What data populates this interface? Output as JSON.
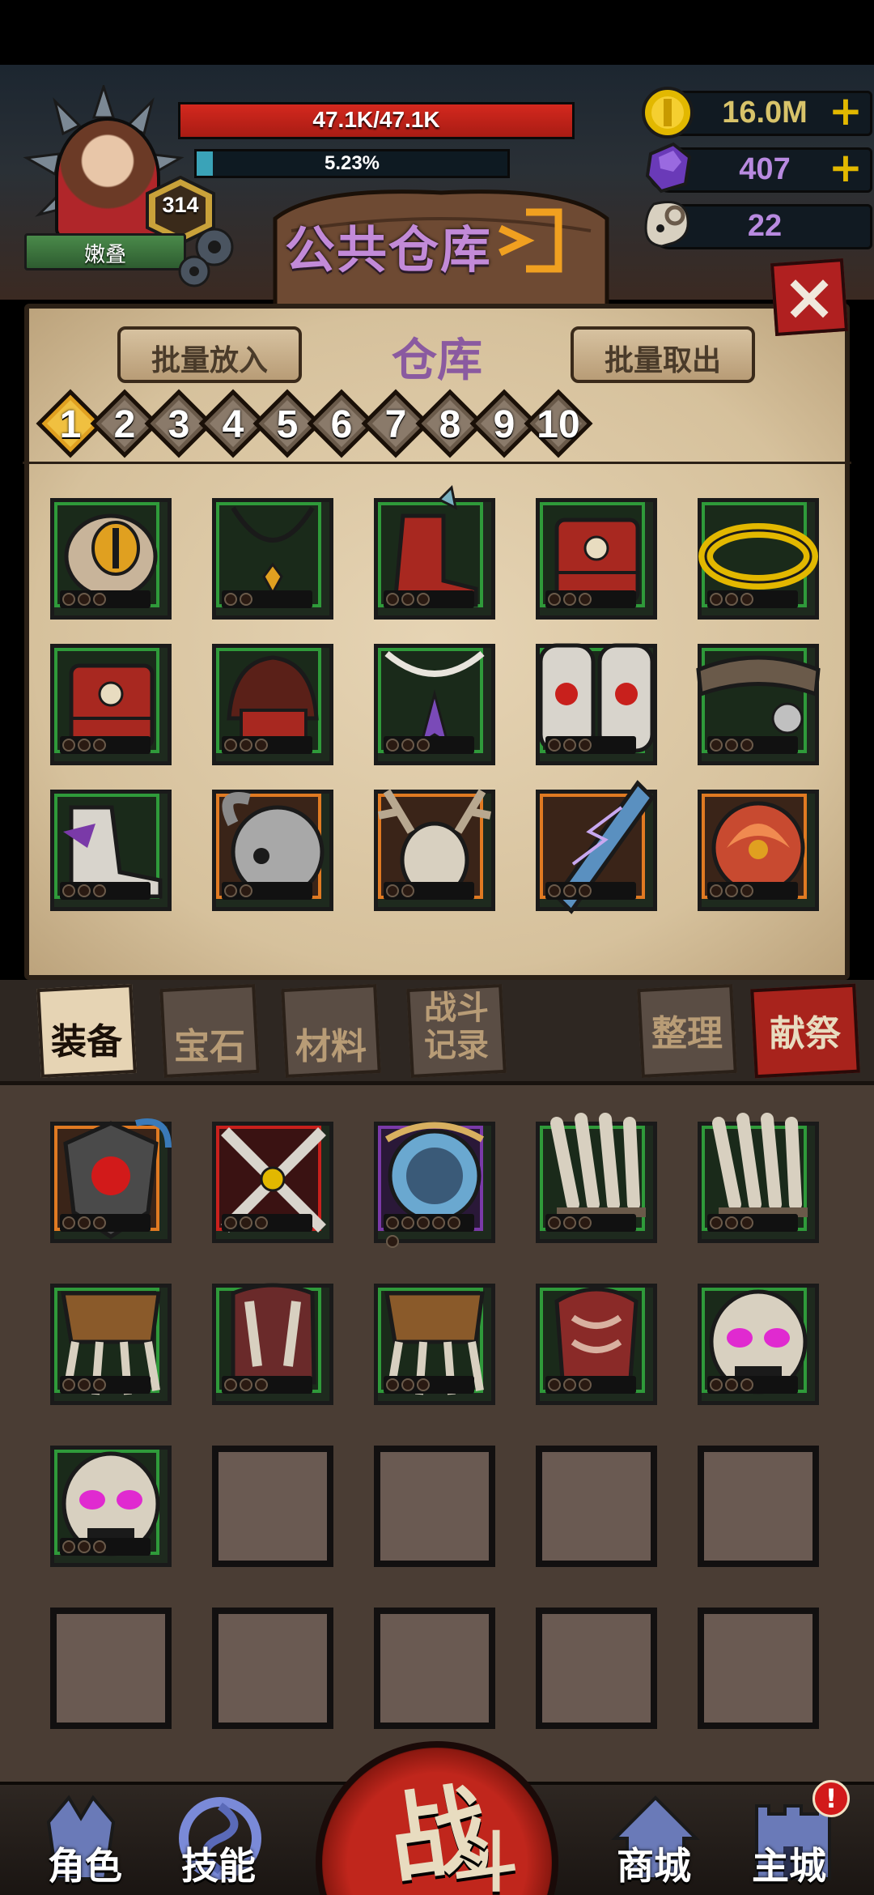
{
  "player": {
    "name": "嫩叠",
    "level": "314"
  },
  "hp": {
    "text": "47.1K/47.1K",
    "fraction": 1.0
  },
  "xp": {
    "text": "5.23%",
    "fraction": 0.0523
  },
  "title": "公共仓库",
  "resources": [
    {
      "name": "gold",
      "value": "16.0M",
      "has_plus": true
    },
    {
      "name": "gem",
      "value": "407",
      "has_plus": true
    },
    {
      "name": "skull",
      "value": "22",
      "has_plus": false
    }
  ],
  "warehouse": {
    "label": "仓库",
    "batch_in": "批量放入",
    "batch_out": "批量取出",
    "pages": [
      "1",
      "2",
      "3",
      "4",
      "5",
      "6",
      "7",
      "8",
      "9",
      "10"
    ],
    "selected_page": "1",
    "items": [
      {
        "name": "eye-ring",
        "rarity": "green",
        "dots": 3
      },
      {
        "name": "necklace",
        "rarity": "green",
        "dots": 2
      },
      {
        "name": "spiked-boots",
        "rarity": "green",
        "dots": 3
      },
      {
        "name": "samurai-armor",
        "rarity": "green",
        "dots": 3
      },
      {
        "name": "gold-rope",
        "rarity": "green",
        "dots": 3
      },
      {
        "name": "samurai-armor",
        "rarity": "green",
        "dots": 3
      },
      {
        "name": "samurai-helmet",
        "rarity": "green",
        "dots": 3
      },
      {
        "name": "laurel-necklace",
        "rarity": "green",
        "dots": 3
      },
      {
        "name": "eye-bracers",
        "rarity": "green",
        "dots": 3
      },
      {
        "name": "spiked-belt",
        "rarity": "green",
        "dots": 3
      },
      {
        "name": "purple-boots",
        "rarity": "green",
        "dots": 3
      },
      {
        "name": "horned-skull",
        "rarity": "orange",
        "dots": 2
      },
      {
        "name": "antler-skull",
        "rarity": "orange",
        "dots": 2
      },
      {
        "name": "lightning-blade",
        "rarity": "orange",
        "dots": 3
      },
      {
        "name": "flame-orb",
        "rarity": "orange",
        "dots": 3
      }
    ]
  },
  "inventory_tabs": [
    "装备",
    "宝石",
    "材料",
    "战斗记录",
    "整理",
    "献祭"
  ],
  "inventory": {
    "items": [
      {
        "name": "dragon-shield",
        "rarity": "orange",
        "dots": 3
      },
      {
        "name": "crossed-swords",
        "rarity": "red",
        "dots": 3
      },
      {
        "name": "crystal-orb",
        "rarity": "purple",
        "dots": 6
      },
      {
        "name": "bone-claws",
        "rarity": "green",
        "dots": 3
      },
      {
        "name": "bone-claws",
        "rarity": "green",
        "dots": 3
      },
      {
        "name": "bone-skirt",
        "rarity": "green",
        "dots": 3
      },
      {
        "name": "bone-armor",
        "rarity": "green",
        "dots": 3
      },
      {
        "name": "bone-skirt",
        "rarity": "green",
        "dots": 3
      },
      {
        "name": "bone-chest",
        "rarity": "green",
        "dots": 3
      },
      {
        "name": "demon-skull",
        "rarity": "green",
        "dots": 3
      },
      {
        "name": "demon-skull",
        "rarity": "green",
        "dots": 3
      },
      {
        "name": "empty",
        "rarity": "empty",
        "dots": 0
      },
      {
        "name": "empty",
        "rarity": "empty",
        "dots": 0
      },
      {
        "name": "empty",
        "rarity": "empty",
        "dots": 0
      },
      {
        "name": "empty",
        "rarity": "empty",
        "dots": 0
      },
      {
        "name": "empty",
        "rarity": "empty",
        "dots": 0
      },
      {
        "name": "empty",
        "rarity": "empty",
        "dots": 0
      },
      {
        "name": "empty",
        "rarity": "empty",
        "dots": 0
      },
      {
        "name": "empty",
        "rarity": "empty",
        "dots": 0
      },
      {
        "name": "empty",
        "rarity": "empty",
        "dots": 0
      }
    ]
  },
  "nav": {
    "role": "角色",
    "skills": "技能",
    "battle_main": "战",
    "battle_sub": "斗",
    "shop": "商城",
    "city": "主城",
    "alert": "!"
  },
  "colors": {
    "green": "#2f9a3a",
    "orange": "#e07a22",
    "red": "#c8201c",
    "purple": "#7a3aa8",
    "accent": "#c28ad8"
  }
}
